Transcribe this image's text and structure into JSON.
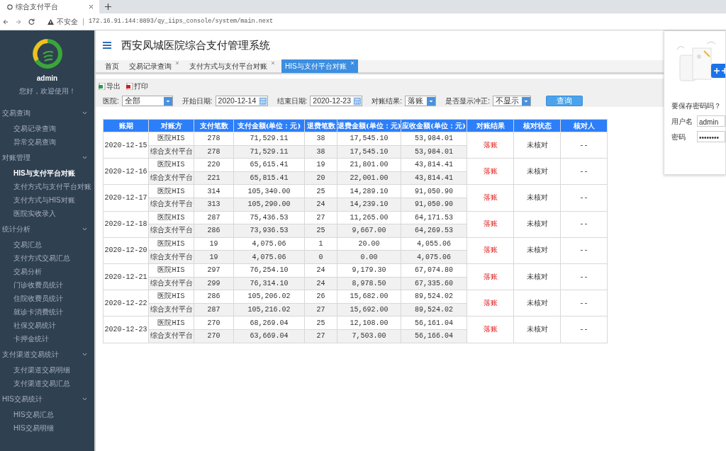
{
  "browser": {
    "tab_title": "综合支付平台",
    "url_warning": "不安全",
    "url": "172.16.91.144:8893/qy_iips_console/system/main.next"
  },
  "sidebar": {
    "user": "admin",
    "greeting": "您好，欢迎使用！",
    "groups": [
      {
        "label": "交易查询",
        "expanded": true,
        "items": [
          {
            "label": "交易记录查询",
            "selected": false
          },
          {
            "label": "异常交易查询",
            "selected": false
          }
        ]
      },
      {
        "label": "对账管理",
        "expanded": true,
        "items": [
          {
            "label": "HIS与支付平台对账",
            "selected": true
          },
          {
            "label": "支付方式与支付平台对账",
            "selected": false
          },
          {
            "label": "支付方式与HIS对账",
            "selected": false
          },
          {
            "label": "医院实收录入",
            "selected": false
          }
        ]
      },
      {
        "label": "统计分析",
        "expanded": true,
        "items": [
          {
            "label": "交易汇总",
            "selected": false
          },
          {
            "label": "支付方式交易汇总",
            "selected": false
          },
          {
            "label": "交易分析",
            "selected": false
          },
          {
            "label": "门诊收费员统计",
            "selected": false
          },
          {
            "label": "住院收费员统计",
            "selected": false
          },
          {
            "label": "就诊卡消费统计",
            "selected": false
          },
          {
            "label": "社保交易统计",
            "selected": false
          },
          {
            "label": "卡押金统计",
            "selected": false
          }
        ]
      },
      {
        "label": "支付渠道交易统计",
        "expanded": true,
        "items": [
          {
            "label": "支付渠道交易明细",
            "selected": false
          },
          {
            "label": "支付渠道交易汇总",
            "selected": false
          }
        ]
      },
      {
        "label": "HIS交易统计",
        "expanded": true,
        "items": [
          {
            "label": "HIS交易汇总",
            "selected": false
          },
          {
            "label": "HIS交易明细",
            "selected": false
          }
        ]
      }
    ]
  },
  "header": {
    "title": "西安凤城医院综合支付管理系统"
  },
  "tabs": [
    {
      "label": "首页",
      "selected": false,
      "closable": false
    },
    {
      "label": "交易记录查询",
      "selected": false,
      "closable": true
    },
    {
      "label": "支付方式与支付平台对账",
      "selected": false,
      "closable": true
    },
    {
      "label": "HIS与支付平台对账",
      "selected": true,
      "closable": true
    }
  ],
  "toolbar": [
    {
      "label": "导出",
      "kind": "excel"
    },
    {
      "label": "打印",
      "kind": "pdf"
    }
  ],
  "filters": [
    {
      "label": "医院:",
      "value": "全部",
      "kind": "select"
    },
    {
      "label": "开始日期:",
      "value": "2020-12-14",
      "kind": "date"
    },
    {
      "label": "结束日期:",
      "value": "2020-12-23",
      "kind": "date"
    },
    {
      "label": "对账结果:",
      "value": "落账",
      "kind": "select"
    },
    {
      "label": "是否显示冲正:",
      "value": "不显示",
      "kind": "select"
    }
  ],
  "query_button": "查询",
  "table": {
    "columns": [
      "账期",
      "对账方",
      "支付笔数",
      "支付金额(单位：元)",
      "退费笔数",
      "退费金额(单位：元)",
      "应收金额(单位：元)",
      "对账结果",
      "核对状态",
      "核对人"
    ],
    "rows": [
      {
        "period": "2020-12-15",
        "result": "落账",
        "status": "未核对",
        "checker": "--",
        "parties": [
          [
            "医院HIS",
            "278",
            "71,529.11",
            "38",
            "17,545.10",
            "53,984.01"
          ],
          [
            "综合支付平台",
            "278",
            "71,529.11",
            "38",
            "17,545.10",
            "53,984.01"
          ]
        ]
      },
      {
        "period": "2020-12-16",
        "result": "落账",
        "status": "未核对",
        "checker": "--",
        "parties": [
          [
            "医院HIS",
            "220",
            "65,615.41",
            "19",
            "21,801.00",
            "43,814.41"
          ],
          [
            "综合支付平台",
            "221",
            "65,815.41",
            "20",
            "22,001.00",
            "43,814.41"
          ]
        ]
      },
      {
        "period": "2020-12-17",
        "result": "落账",
        "status": "未核对",
        "checker": "--",
        "parties": [
          [
            "医院HIS",
            "314",
            "105,340.00",
            "25",
            "14,289.10",
            "91,050.90"
          ],
          [
            "综合支付平台",
            "313",
            "105,290.00",
            "24",
            "14,239.10",
            "91,050.90"
          ]
        ]
      },
      {
        "period": "2020-12-18",
        "result": "落账",
        "status": "未核对",
        "checker": "--",
        "parties": [
          [
            "医院HIS",
            "287",
            "75,436.53",
            "27",
            "11,265.00",
            "64,171.53"
          ],
          [
            "综合支付平台",
            "286",
            "73,936.53",
            "25",
            "9,667.00",
            "64,269.53"
          ]
        ]
      },
      {
        "period": "2020-12-20",
        "result": "落账",
        "status": "未核对",
        "checker": "--",
        "parties": [
          [
            "医院HIS",
            "19",
            "4,075.06",
            "1",
            "20.00",
            "4,055.06"
          ],
          [
            "综合支付平台",
            "19",
            "4,075.06",
            "0",
            "0.00",
            "4,075.06"
          ]
        ]
      },
      {
        "period": "2020-12-21",
        "result": "落账",
        "status": "未核对",
        "checker": "--",
        "parties": [
          [
            "医院HIS",
            "297",
            "76,254.10",
            "24",
            "9,179.30",
            "67,074.80"
          ],
          [
            "综合支付平台",
            "299",
            "76,314.10",
            "24",
            "8,978.50",
            "67,335.60"
          ]
        ]
      },
      {
        "period": "2020-12-22",
        "result": "落账",
        "status": "未核对",
        "checker": "--",
        "parties": [
          [
            "医院HIS",
            "286",
            "105,206.02",
            "26",
            "15,682.00",
            "89,524.02"
          ],
          [
            "综合支付平台",
            "287",
            "105,216.02",
            "27",
            "15,692.00",
            "89,524.02"
          ]
        ]
      },
      {
        "period": "2020-12-23",
        "result": "落账",
        "status": "未核对",
        "checker": "--",
        "parties": [
          [
            "医院HIS",
            "270",
            "68,269.04",
            "25",
            "12,108.00",
            "56,161.04"
          ],
          [
            "综合支付平台",
            "270",
            "63,669.04",
            "27",
            "7,503.00",
            "56,166.04"
          ]
        ]
      }
    ]
  },
  "password_popup": {
    "title": "要保存密码吗？",
    "username_label": "用户名",
    "username": "admin",
    "password_label": "密码",
    "password": "••••••••"
  }
}
